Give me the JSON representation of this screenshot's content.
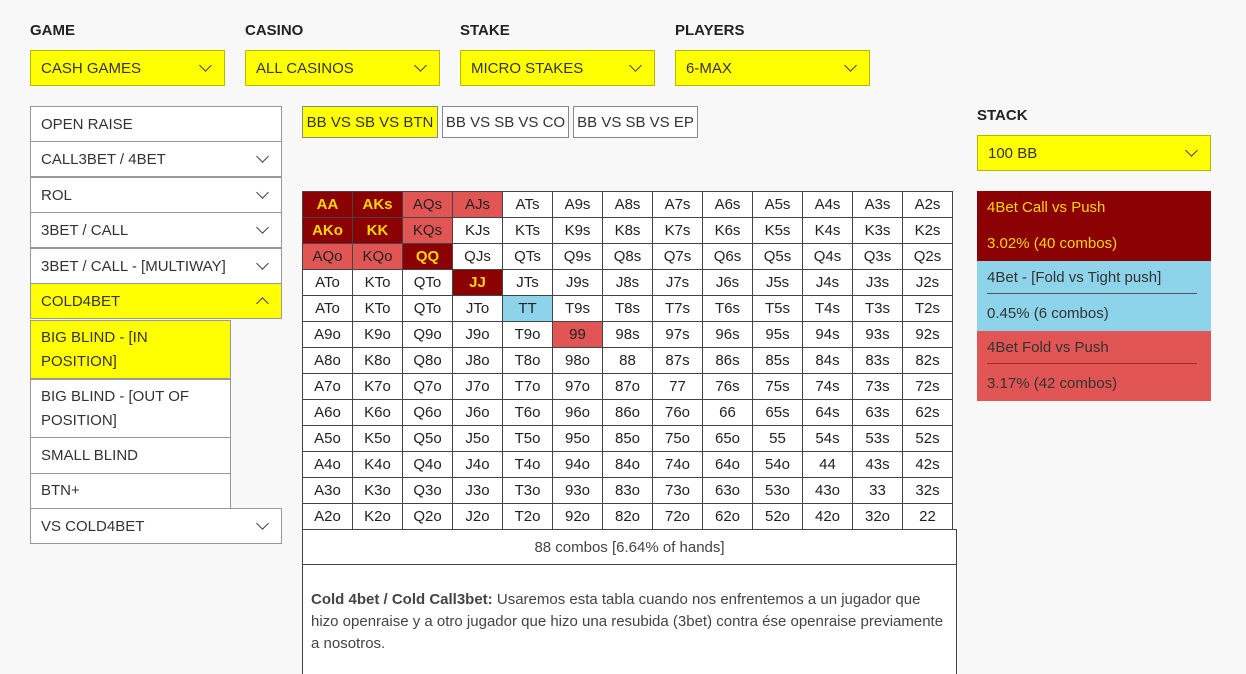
{
  "filters": {
    "game": {
      "label": "GAME",
      "value": "CASH GAMES"
    },
    "casino": {
      "label": "CASINO",
      "value": "ALL CASINOS"
    },
    "stake": {
      "label": "STAKE",
      "value": "MICRO STAKES"
    },
    "players": {
      "label": "PLAYERS",
      "value": "6-MAX"
    }
  },
  "menu": {
    "open_raise": "OPEN RAISE",
    "call3bet_4bet": "CALL3BET / 4BET",
    "rol": "ROL",
    "threebet_call": "3BET / CALL",
    "threebet_call_multiway": "3BET / CALL - [MULTIWAY]",
    "cold4bet": "COLD4BET",
    "sub": {
      "bb_in": "BIG BLIND - [IN POSITION]",
      "bb_out": "BIG BLIND - [OUT OF POSITION]",
      "sb": "SMALL BLIND",
      "btn": "BTN+"
    },
    "vs_cold4bet": "VS COLD4BET"
  },
  "tabs": [
    "BB VS SB VS BTN",
    "BB VS SB VS CO",
    "BB VS SB VS EP"
  ],
  "stack": {
    "label": "STACK",
    "value": "100 BB"
  },
  "legend": [
    {
      "title": "4Bet Call vs Push",
      "value": "3.02%  (40 combos)",
      "bg": "#8b0000",
      "fg": "#ffd700",
      "div": "#8b0000"
    },
    {
      "title": "4Bet - [Fold vs Tight push]",
      "value": "0.45%  (6 combos)",
      "bg": "#8dd3ea",
      "fg": "#333333",
      "div": "#555555"
    },
    {
      "title": "4Bet Fold vs Push",
      "value": "3.17%  (42 combos)",
      "bg": "#e25555",
      "fg": "#333333",
      "div": "#9a2a2a"
    }
  ],
  "grid": {
    "rows": [
      [
        "AA",
        "AKs",
        "AQs",
        "AJs",
        "ATs",
        "A9s",
        "A8s",
        "A7s",
        "A6s",
        "A5s",
        "A4s",
        "A3s",
        "A2s"
      ],
      [
        "AKo",
        "KK",
        "KQs",
        "KJs",
        "KTs",
        "K9s",
        "K8s",
        "K7s",
        "K6s",
        "K5s",
        "K4s",
        "K3s",
        "K2s"
      ],
      [
        "AQo",
        "KQo",
        "QQ",
        "QJs",
        "QTs",
        "Q9s",
        "Q8s",
        "Q7s",
        "Q6s",
        "Q5s",
        "Q4s",
        "Q3s",
        "Q2s"
      ],
      [
        "ATo",
        "KTo",
        "QTo",
        "JJ",
        "JTs",
        "J9s",
        "J8s",
        "J7s",
        "J6s",
        "J5s",
        "J4s",
        "J3s",
        "J2s"
      ],
      [
        "ATo",
        "KTo",
        "QTo",
        "JTo",
        "TT",
        "T9s",
        "T8s",
        "T7s",
        "T6s",
        "T5s",
        "T4s",
        "T3s",
        "T2s"
      ],
      [
        "A9o",
        "K9o",
        "Q9o",
        "J9o",
        "T9o",
        "99",
        "98s",
        "97s",
        "96s",
        "95s",
        "94s",
        "93s",
        "92s"
      ],
      [
        "A8o",
        "K8o",
        "Q8o",
        "J8o",
        "T8o",
        "98o",
        "88",
        "87s",
        "86s",
        "85s",
        "84s",
        "83s",
        "82s"
      ],
      [
        "A7o",
        "K7o",
        "Q7o",
        "J7o",
        "T7o",
        "97o",
        "87o",
        "77",
        "76s",
        "75s",
        "74s",
        "73s",
        "72s"
      ],
      [
        "A6o",
        "K6o",
        "Q6o",
        "J6o",
        "T6o",
        "96o",
        "86o",
        "76o",
        "66",
        "65s",
        "64s",
        "63s",
        "62s"
      ],
      [
        "A5o",
        "K5o",
        "Q5o",
        "J5o",
        "T5o",
        "95o",
        "85o",
        "75o",
        "65o",
        "55",
        "54s",
        "53s",
        "52s"
      ],
      [
        "A4o",
        "K4o",
        "Q4o",
        "J4o",
        "T4o",
        "94o",
        "84o",
        "74o",
        "64o",
        "54o",
        "44",
        "43s",
        "42s"
      ],
      [
        "A3o",
        "K3o",
        "Q3o",
        "J3o",
        "T3o",
        "93o",
        "83o",
        "73o",
        "63o",
        "53o",
        "43o",
        "33",
        "32s"
      ],
      [
        "A2o",
        "K2o",
        "Q2o",
        "J2o",
        "T2o",
        "92o",
        "82o",
        "72o",
        "62o",
        "52o",
        "42o",
        "32o",
        "22"
      ]
    ],
    "call": [
      "AA",
      "AKs",
      "AKo",
      "KK",
      "QQ",
      "JJ"
    ],
    "tight": [
      "TT"
    ],
    "fold": [
      "AQs",
      "AJs",
      "KQs",
      "AQo",
      "KQo",
      "99"
    ]
  },
  "combos_summary": "88 combos [6.64% of hands]",
  "description": {
    "bold": "Cold 4bet / Cold Call3bet:",
    "text": " Usaremos esta tabla cuando nos enfrentemos a un jugador que hizo openraise y a otro jugador que hizo una resubida (3bet) contra ése openraise previamente a nosotros."
  }
}
